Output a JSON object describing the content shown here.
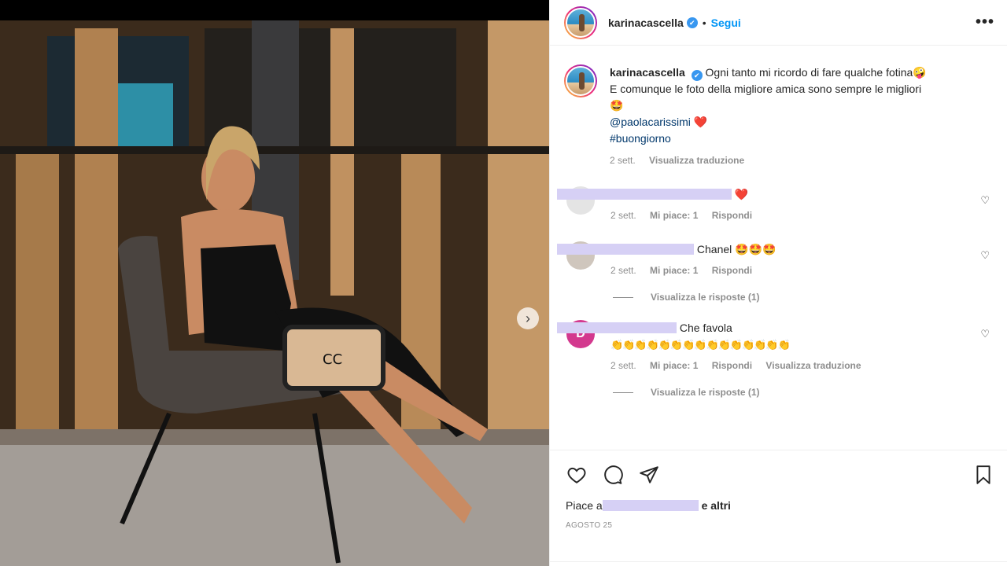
{
  "post": {
    "username": "karinacascella",
    "verified": "✔",
    "dot": "•",
    "follow_label": "Segui",
    "more_label": "•••"
  },
  "caption": {
    "username": "karinacascella",
    "line1": "Ogni tanto mi ricordo di fare qualche fotina🤪",
    "line2": "E comunque le foto della migliore amica sono sempre le migliori",
    "line3": "🤩",
    "mention": "@paolacarissimi",
    "mention_emoji": "❤️",
    "hashtag": "#buongiorno",
    "time": "2 sett.",
    "translate": "Visualizza traduzione"
  },
  "comments": [
    {
      "text": "❤️",
      "time": "2 sett.",
      "likes": "Mi piace: 1",
      "reply": "Rispondi",
      "translate": "",
      "view_replies": ""
    },
    {
      "text": "Chanel 🤩🤩🤩",
      "time": "2 sett.",
      "likes": "Mi piace: 1",
      "reply": "Rispondi",
      "translate": "",
      "view_replies": "Visualizza le risposte (1)"
    },
    {
      "avatar_letter": "D",
      "text": "Che favola",
      "text2": "👏👏👏👏👏👏👏👏👏👏👏👏👏👏👏",
      "time": "2 sett.",
      "likes": "Mi piace: 1",
      "reply": "Rispondi",
      "translate": "Visualizza traduzione",
      "view_replies": "Visualizza le risposte (1)"
    }
  ],
  "actions": {
    "likes_prefix": "Piace a",
    "likes_suffix": "e altri",
    "date": "AGOSTO 25"
  },
  "colors": {
    "follow": "#0095f6",
    "muted": "#8e8e8e",
    "redaction": "#d6d0f5",
    "heart": "#e0245e"
  }
}
